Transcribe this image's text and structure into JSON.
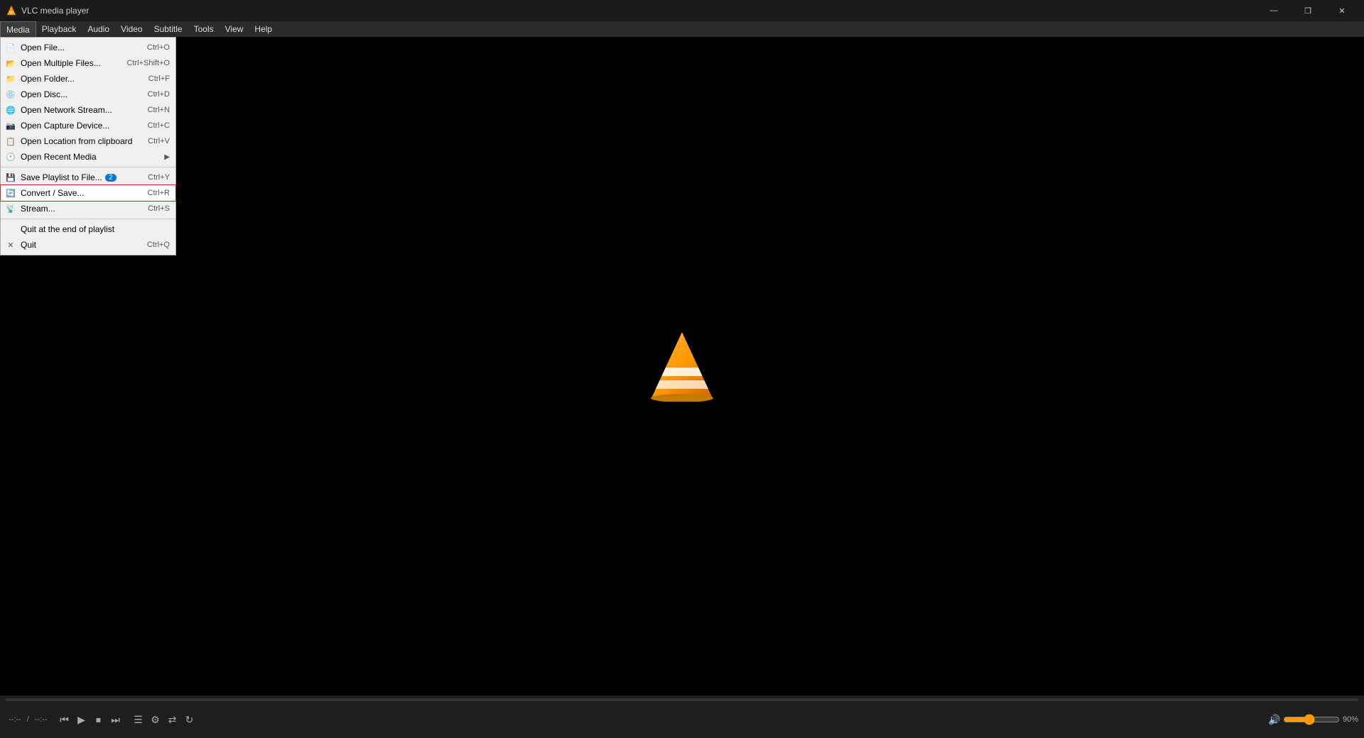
{
  "titlebar": {
    "title": "VLC media player",
    "icon": "vlc-icon",
    "controls": {
      "minimize": "—",
      "maximize": "❐",
      "close": "✕"
    }
  },
  "menubar": {
    "items": [
      {
        "label": "Media",
        "active": true
      },
      {
        "label": "Playback",
        "active": false
      },
      {
        "label": "Audio",
        "active": false
      },
      {
        "label": "Video",
        "active": false
      },
      {
        "label": "Subtitle",
        "active": false
      },
      {
        "label": "Tools",
        "active": false
      },
      {
        "label": "View",
        "active": false
      },
      {
        "label": "Help",
        "active": false
      }
    ]
  },
  "dropdown": {
    "items": [
      {
        "label": "Open File...",
        "shortcut": "Ctrl+O",
        "icon": "file",
        "separator_after": false
      },
      {
        "label": "Open Multiple Files...",
        "shortcut": "Ctrl+Shift+O",
        "icon": "files",
        "separator_after": false
      },
      {
        "label": "Open Folder...",
        "shortcut": "Ctrl+F",
        "icon": "folder",
        "separator_after": false
      },
      {
        "label": "Open Disc...",
        "shortcut": "Ctrl+D",
        "icon": "disc",
        "separator_after": false
      },
      {
        "label": "Open Network Stream...",
        "shortcut": "Ctrl+N",
        "icon": "network",
        "separator_after": false
      },
      {
        "label": "Open Capture Device...",
        "shortcut": "Ctrl+C",
        "icon": "capture",
        "separator_after": false
      },
      {
        "label": "Open Location from clipboard",
        "shortcut": "Ctrl+V",
        "icon": "clipboard",
        "separator_after": false
      },
      {
        "label": "Open Recent Media",
        "shortcut": "",
        "icon": "recent",
        "hasArrow": true,
        "separator_after": true
      },
      {
        "label": "Save Playlist to File...",
        "shortcut": "Ctrl+Y",
        "icon": "save",
        "badge": "2",
        "separator_after": false
      },
      {
        "label": "Convert / Save...",
        "shortcut": "Ctrl+R",
        "icon": "convert",
        "highlighted": true,
        "separator_after": false
      },
      {
        "label": "Stream...",
        "shortcut": "Ctrl+S",
        "icon": "stream",
        "separator_after": true
      },
      {
        "label": "Quit at the end of playlist",
        "shortcut": "",
        "icon": "",
        "separator_after": false
      },
      {
        "label": "Quit",
        "shortcut": "Ctrl+Q",
        "icon": "quit",
        "separator_after": false
      }
    ]
  },
  "controls": {
    "play": "▶",
    "prev": "⏮",
    "stop": "⏹",
    "next": "⏭",
    "toggle_playlist": "☰",
    "extended": "⚙",
    "shuffle": "⇄",
    "repeat": "↻",
    "volume": "90%",
    "time": "--:--",
    "duration": "--:--"
  }
}
